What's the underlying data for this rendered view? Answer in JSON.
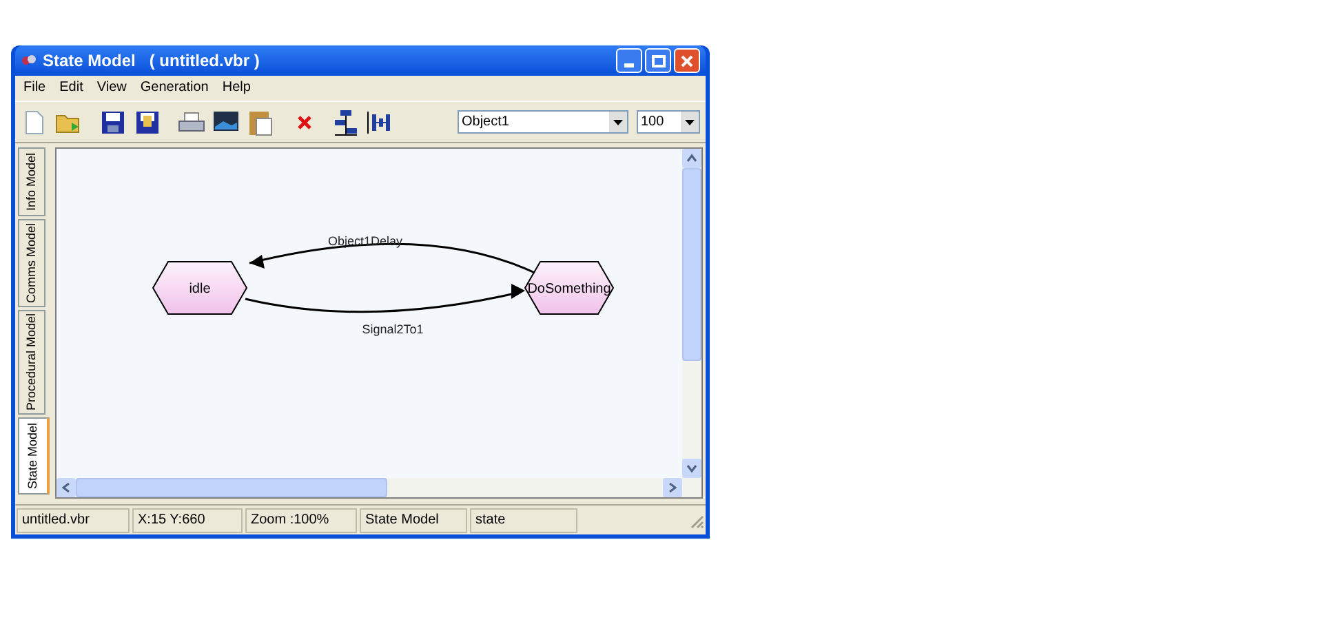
{
  "window": {
    "title": "State Model   ( untitled.vbr )"
  },
  "menu": [
    "File",
    "Edit",
    "View",
    "Generation",
    "Help"
  ],
  "toolbar": {
    "object_combo": "Object1",
    "zoom_combo": "100"
  },
  "side_tabs": [
    {
      "label": "Info Model",
      "selected": false
    },
    {
      "label": "Comms Model",
      "selected": false
    },
    {
      "label": "Procedural Model",
      "selected": false
    },
    {
      "label": "State Model",
      "selected": true
    }
  ],
  "diagram": {
    "states": [
      {
        "label": "idle"
      },
      {
        "label": "DoSomething"
      }
    ],
    "transitions": [
      {
        "label": "Object1Delay"
      },
      {
        "label": "Signal2To1"
      }
    ]
  },
  "status_bar": [
    "untitled.vbr",
    "X:15 Y:660",
    "Zoom :100%",
    "State Model",
    "state"
  ]
}
